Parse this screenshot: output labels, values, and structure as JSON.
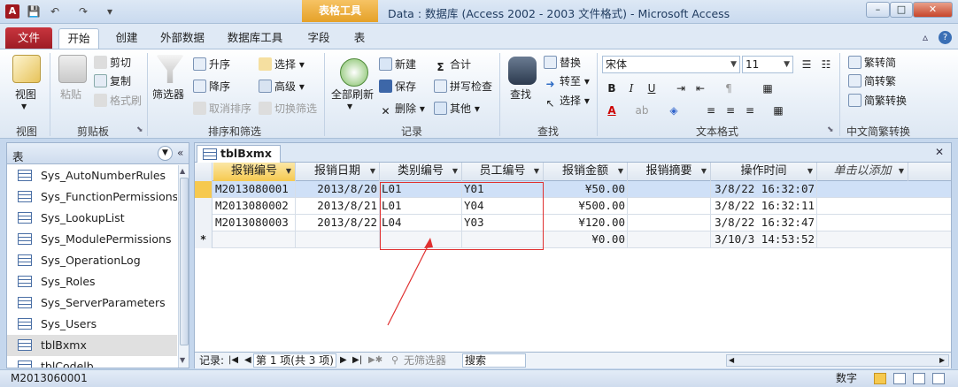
{
  "window": {
    "app_icon": "A",
    "context_tab_title": "表格工具",
    "title": "Data : 数据库 (Access 2002 - 2003 文件格式) - Microsoft Access",
    "controls": {
      "minimize": "–",
      "maximize": "□",
      "close": "✕"
    }
  },
  "qat": {
    "save": "💾",
    "undo": "↶",
    "redo": "↷",
    "customize": "▾"
  },
  "ribbon_tabs": {
    "file": "文件",
    "tabs": [
      "开始",
      "创建",
      "外部数据",
      "数据库工具",
      "字段",
      "表"
    ],
    "active": "开始",
    "minimize": "▵",
    "help": "?"
  },
  "ribbon": {
    "view": {
      "label": "视图",
      "group": "视图"
    },
    "clipboard": {
      "paste": "粘贴",
      "cut": "剪切",
      "copy": "复制",
      "format_painter": "格式刷",
      "group": "剪贴板"
    },
    "sort_filter": {
      "filter": "筛选器",
      "ascending": "升序",
      "descending": "降序",
      "remove_sort": "取消排序",
      "selection": "选择",
      "advanced": "高级",
      "toggle_filter": "切换筛选",
      "group": "排序和筛选"
    },
    "records": {
      "refresh_all": "全部刷新",
      "new": "新建",
      "save": "保存",
      "delete": "删除",
      "totals": "合计",
      "spelling": "拼写检查",
      "more": "其他",
      "group": "记录"
    },
    "find": {
      "find": "查找",
      "replace": "替换",
      "goto": "转至",
      "select": "选择",
      "group": "查找"
    },
    "text_format": {
      "font": "宋体",
      "size": "11",
      "bold": "B",
      "italic": "I",
      "underline": "U",
      "group": "文本格式"
    },
    "chinese_conv": {
      "to_trad_simp": "繁转简",
      "to_simp": "简转繁",
      "convert": "简繁转换",
      "group": "中文简繁转换"
    }
  },
  "nav_pane": {
    "title": "表",
    "items": [
      {
        "label": "Sys_AutoNumberRules"
      },
      {
        "label": "Sys_FunctionPermissions"
      },
      {
        "label": "Sys_LookupList"
      },
      {
        "label": "Sys_ModulePermissions"
      },
      {
        "label": "Sys_OperationLog"
      },
      {
        "label": "Sys_Roles"
      },
      {
        "label": "Sys_ServerParameters"
      },
      {
        "label": "Sys_Users"
      },
      {
        "label": "tblBxmx"
      },
      {
        "label": "tblCodelb"
      }
    ],
    "selected": "tblBxmx"
  },
  "document": {
    "tab": "tblBxmx",
    "columns": [
      "报销编号",
      "报销日期",
      "类别编号",
      "员工编号",
      "报销金额",
      "报销摘要",
      "操作时间",
      "单击以添加"
    ],
    "rows": [
      {
        "id": "M2013080001",
        "date": "2013/8/20",
        "category": "L01",
        "employee": "Y01",
        "amount": "¥50.00",
        "summary": "",
        "time": "3/8/22 16:32:07"
      },
      {
        "id": "M2013080002",
        "date": "2013/8/21",
        "category": "L01",
        "employee": "Y04",
        "amount": "¥500.00",
        "summary": "",
        "time": "3/8/22 16:32:11"
      },
      {
        "id": "M2013080003",
        "date": "2013/8/22",
        "category": "L04",
        "employee": "Y03",
        "amount": "¥120.00",
        "summary": "",
        "time": "3/8/22 16:32:47"
      }
    ],
    "new_row": {
      "marker": "*",
      "amount": "¥0.00",
      "time": "3/10/3 14:53:52"
    }
  },
  "record_bar": {
    "label": "记录:",
    "position": "第 1 项(共 3 项)",
    "filter": "无筛选器",
    "search": "搜索"
  },
  "status_bar": {
    "left": "M2013060001",
    "mode": "数字"
  },
  "colors": {
    "accent_red": "#e03030",
    "file_tab": "#b22a33",
    "selected_row": "#cfe0f7",
    "header_highlight": "#f6c94f"
  }
}
